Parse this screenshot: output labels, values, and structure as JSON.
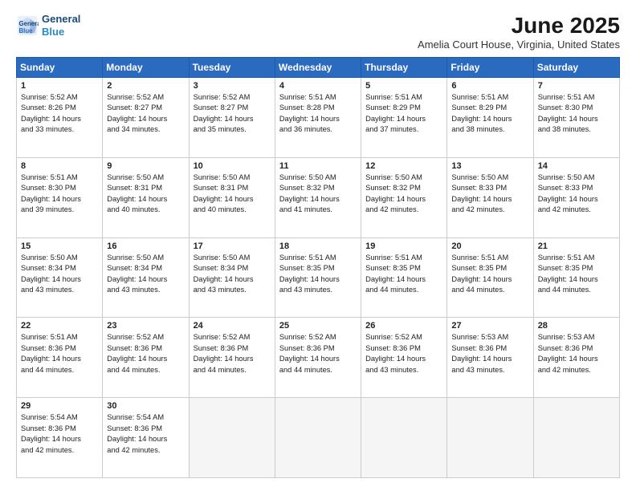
{
  "logo": {
    "line1": "General",
    "line2": "Blue"
  },
  "title": "June 2025",
  "subtitle": "Amelia Court House, Virginia, United States",
  "headers": [
    "Sunday",
    "Monday",
    "Tuesday",
    "Wednesday",
    "Thursday",
    "Friday",
    "Saturday"
  ],
  "weeks": [
    [
      {
        "day": "1",
        "info": "Sunrise: 5:52 AM\nSunset: 8:26 PM\nDaylight: 14 hours\nand 33 minutes."
      },
      {
        "day": "2",
        "info": "Sunrise: 5:52 AM\nSunset: 8:27 PM\nDaylight: 14 hours\nand 34 minutes."
      },
      {
        "day": "3",
        "info": "Sunrise: 5:52 AM\nSunset: 8:27 PM\nDaylight: 14 hours\nand 35 minutes."
      },
      {
        "day": "4",
        "info": "Sunrise: 5:51 AM\nSunset: 8:28 PM\nDaylight: 14 hours\nand 36 minutes."
      },
      {
        "day": "5",
        "info": "Sunrise: 5:51 AM\nSunset: 8:29 PM\nDaylight: 14 hours\nand 37 minutes."
      },
      {
        "day": "6",
        "info": "Sunrise: 5:51 AM\nSunset: 8:29 PM\nDaylight: 14 hours\nand 38 minutes."
      },
      {
        "day": "7",
        "info": "Sunrise: 5:51 AM\nSunset: 8:30 PM\nDaylight: 14 hours\nand 38 minutes."
      }
    ],
    [
      {
        "day": "8",
        "info": "Sunrise: 5:51 AM\nSunset: 8:30 PM\nDaylight: 14 hours\nand 39 minutes."
      },
      {
        "day": "9",
        "info": "Sunrise: 5:50 AM\nSunset: 8:31 PM\nDaylight: 14 hours\nand 40 minutes."
      },
      {
        "day": "10",
        "info": "Sunrise: 5:50 AM\nSunset: 8:31 PM\nDaylight: 14 hours\nand 40 minutes."
      },
      {
        "day": "11",
        "info": "Sunrise: 5:50 AM\nSunset: 8:32 PM\nDaylight: 14 hours\nand 41 minutes."
      },
      {
        "day": "12",
        "info": "Sunrise: 5:50 AM\nSunset: 8:32 PM\nDaylight: 14 hours\nand 42 minutes."
      },
      {
        "day": "13",
        "info": "Sunrise: 5:50 AM\nSunset: 8:33 PM\nDaylight: 14 hours\nand 42 minutes."
      },
      {
        "day": "14",
        "info": "Sunrise: 5:50 AM\nSunset: 8:33 PM\nDaylight: 14 hours\nand 42 minutes."
      }
    ],
    [
      {
        "day": "15",
        "info": "Sunrise: 5:50 AM\nSunset: 8:34 PM\nDaylight: 14 hours\nand 43 minutes."
      },
      {
        "day": "16",
        "info": "Sunrise: 5:50 AM\nSunset: 8:34 PM\nDaylight: 14 hours\nand 43 minutes."
      },
      {
        "day": "17",
        "info": "Sunrise: 5:50 AM\nSunset: 8:34 PM\nDaylight: 14 hours\nand 43 minutes."
      },
      {
        "day": "18",
        "info": "Sunrise: 5:51 AM\nSunset: 8:35 PM\nDaylight: 14 hours\nand 43 minutes."
      },
      {
        "day": "19",
        "info": "Sunrise: 5:51 AM\nSunset: 8:35 PM\nDaylight: 14 hours\nand 44 minutes."
      },
      {
        "day": "20",
        "info": "Sunrise: 5:51 AM\nSunset: 8:35 PM\nDaylight: 14 hours\nand 44 minutes."
      },
      {
        "day": "21",
        "info": "Sunrise: 5:51 AM\nSunset: 8:35 PM\nDaylight: 14 hours\nand 44 minutes."
      }
    ],
    [
      {
        "day": "22",
        "info": "Sunrise: 5:51 AM\nSunset: 8:36 PM\nDaylight: 14 hours\nand 44 minutes."
      },
      {
        "day": "23",
        "info": "Sunrise: 5:52 AM\nSunset: 8:36 PM\nDaylight: 14 hours\nand 44 minutes."
      },
      {
        "day": "24",
        "info": "Sunrise: 5:52 AM\nSunset: 8:36 PM\nDaylight: 14 hours\nand 44 minutes."
      },
      {
        "day": "25",
        "info": "Sunrise: 5:52 AM\nSunset: 8:36 PM\nDaylight: 14 hours\nand 44 minutes."
      },
      {
        "day": "26",
        "info": "Sunrise: 5:52 AM\nSunset: 8:36 PM\nDaylight: 14 hours\nand 43 minutes."
      },
      {
        "day": "27",
        "info": "Sunrise: 5:53 AM\nSunset: 8:36 PM\nDaylight: 14 hours\nand 43 minutes."
      },
      {
        "day": "28",
        "info": "Sunrise: 5:53 AM\nSunset: 8:36 PM\nDaylight: 14 hours\nand 42 minutes."
      }
    ],
    [
      {
        "day": "29",
        "info": "Sunrise: 5:54 AM\nSunset: 8:36 PM\nDaylight: 14 hours\nand 42 minutes."
      },
      {
        "day": "30",
        "info": "Sunrise: 5:54 AM\nSunset: 8:36 PM\nDaylight: 14 hours\nand 42 minutes."
      },
      {
        "day": "",
        "info": ""
      },
      {
        "day": "",
        "info": ""
      },
      {
        "day": "",
        "info": ""
      },
      {
        "day": "",
        "info": ""
      },
      {
        "day": "",
        "info": ""
      }
    ]
  ]
}
